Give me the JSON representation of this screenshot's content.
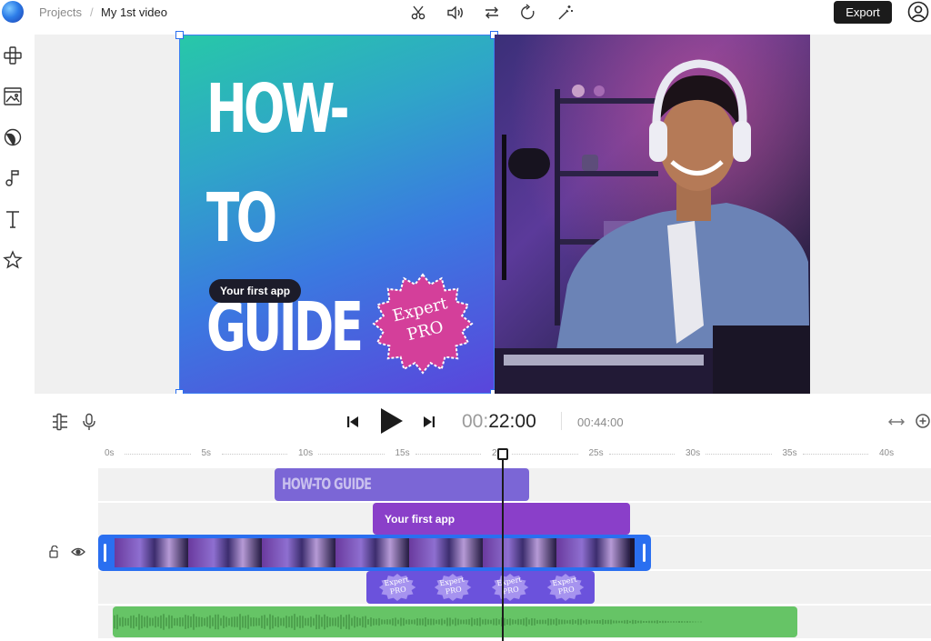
{
  "breadcrumb": {
    "projects": "Projects",
    "separator": "/",
    "title": "My 1st video"
  },
  "toolbar": {
    "tools": [
      "scissors-icon",
      "volume-icon",
      "swap-icon",
      "rotate-icon",
      "magic-wand-icon"
    ],
    "export_label": "Export"
  },
  "sidebar": {
    "items": [
      "elements-icon",
      "media-icon",
      "stickers-icon",
      "music-icon",
      "text-icon",
      "favorites-icon"
    ]
  },
  "canvas": {
    "card_title": "HOW-TO\nGUIDE",
    "card_pill": "Your first app",
    "badge_text": "Expert\nPRO",
    "colors": {
      "gradient_start": "#27c8a8",
      "gradient_end": "#5a45dc",
      "badge": "#d43f9a",
      "selection": "#2a6ff0"
    }
  },
  "player": {
    "current_time_dim": "00:",
    "current_time_bright": "22:00",
    "total_time": "00:44:00"
  },
  "timeline": {
    "ruler_ticks": [
      "0s",
      "5s",
      "10s",
      "15s",
      "20s",
      "25s",
      "30s",
      "35s",
      "40s"
    ],
    "tracks": {
      "title_clip": "HOW-TO GUIDE",
      "pill_clip": "Your first app",
      "sticker_label": "Expert\nPRO",
      "sticker_count": 4
    },
    "playhead_time": "22:00"
  }
}
